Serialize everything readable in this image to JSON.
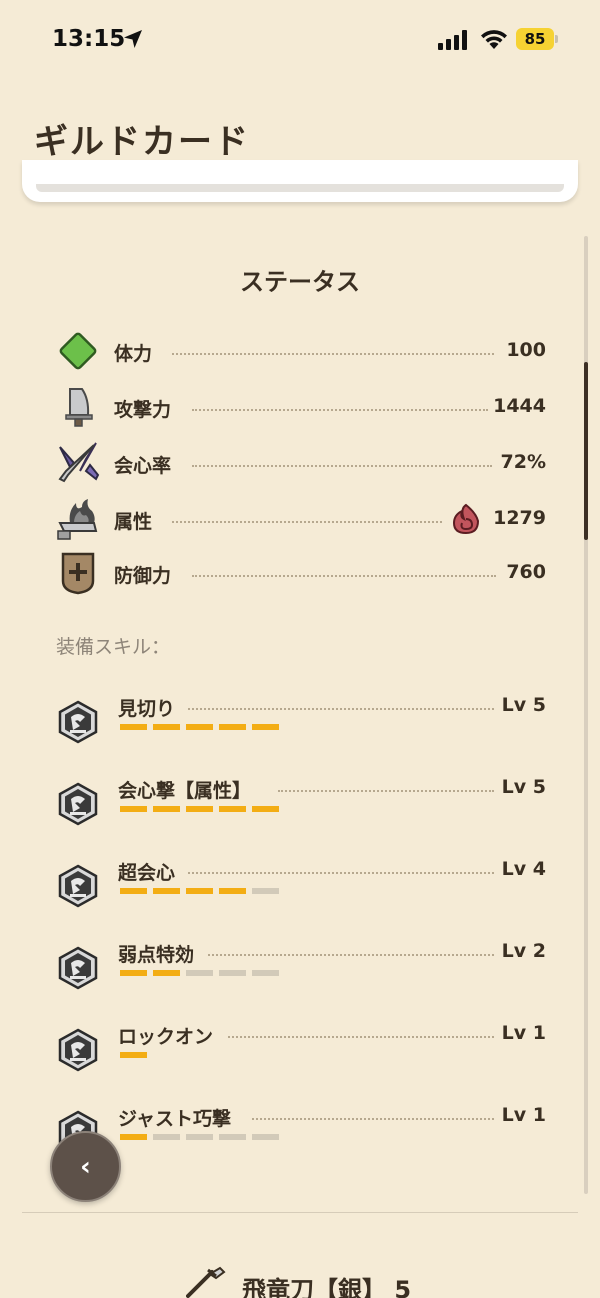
{
  "status_bar": {
    "time": "13:15",
    "battery": "85"
  },
  "header": {
    "title": "ギルドカード"
  },
  "status_section": {
    "title": "ステータス",
    "stats": [
      {
        "icon": "health-icon",
        "label": "体力",
        "value": "100"
      },
      {
        "icon": "attack-icon",
        "label": "攻撃力",
        "value": "1444"
      },
      {
        "icon": "affinity-icon",
        "label": "会心率",
        "value": "72%"
      },
      {
        "icon": "element-icon",
        "label": "属性",
        "value": "1279",
        "badge_icon": "fire-element-icon"
      },
      {
        "icon": "defense-icon",
        "label": "防御力",
        "value": "760"
      }
    ]
  },
  "skills_section": {
    "heading": "装備スキル：",
    "skills": [
      {
        "label": "見切り",
        "level": "Lv 5",
        "max_level": 5,
        "current_level": 5
      },
      {
        "label": "会心撃【属性】",
        "level": "Lv 5",
        "max_level": 5,
        "current_level": 5
      },
      {
        "label": "超会心",
        "level": "Lv 4",
        "max_level": 5,
        "current_level": 4
      },
      {
        "label": "弱点特効",
        "level": "Lv 2",
        "max_level": 5,
        "current_level": 2
      },
      {
        "label": "ロックオン",
        "level": "Lv 1",
        "max_level": 1,
        "current_level": 1
      },
      {
        "label": "ジャスト巧撃",
        "level": "Lv 1",
        "max_level": 5,
        "current_level": 1
      }
    ]
  },
  "weapon": {
    "icon": "long-sword-icon",
    "name": "飛竜刀【銀】 5"
  },
  "colors": {
    "background": "#f5ebd6",
    "text": "#3a2f22",
    "skill_bar_on": "#f3ad14",
    "skill_bar_off": "#d2cab9",
    "health_green": "#6cc04a"
  }
}
